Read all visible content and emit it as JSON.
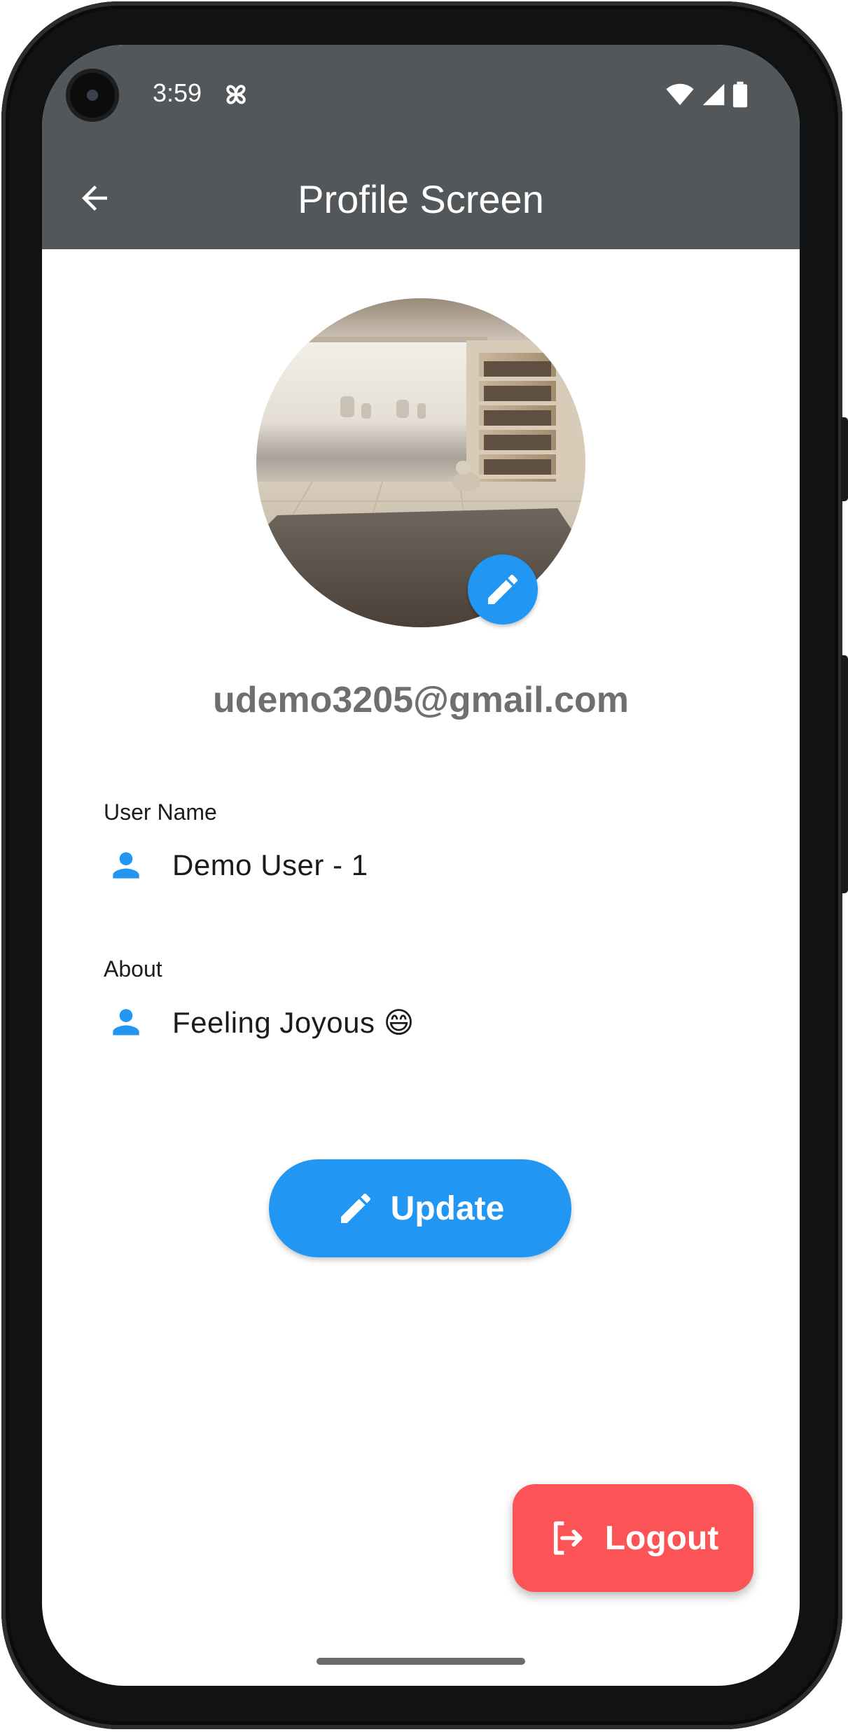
{
  "status_bar": {
    "time": "3:59",
    "icons": [
      "pinwheel-icon",
      "wifi-icon",
      "cellular-signal-icon",
      "battery-icon"
    ]
  },
  "app_bar": {
    "title": "Profile Screen",
    "back_icon": "arrow-back-icon"
  },
  "profile": {
    "email": "udemo3205@gmail.com",
    "avatar_icon": "edit-pencil-icon"
  },
  "fields": {
    "user_name": {
      "label": "User Name",
      "value": "Demo User - 1",
      "icon": "person-icon"
    },
    "about": {
      "label": "About",
      "value": "Feeling Joyous 😄",
      "icon": "person-icon"
    }
  },
  "buttons": {
    "update_label": "Update",
    "logout_label": "Logout"
  },
  "colors": {
    "app_bar": "#53575a",
    "accent": "#2196f3",
    "logout": "#fc5356",
    "email_text": "#6f6f6f"
  }
}
